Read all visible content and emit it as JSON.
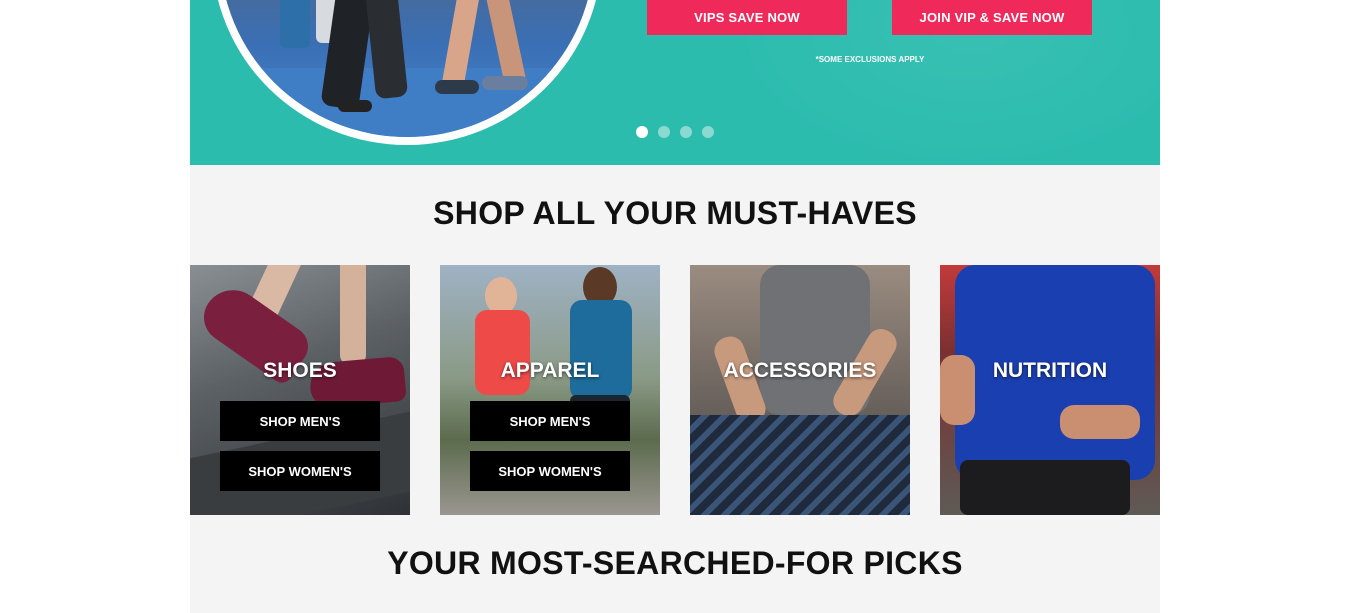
{
  "hero": {
    "btn_vips": "VIPS SAVE NOW",
    "btn_join": "JOIN VIP & SAVE NOW",
    "exclusions": "*SOME EXCLUSIONS APPLY",
    "carousel_active_index": 0,
    "carousel_count": 4
  },
  "sections": {
    "musthaves_title": "SHOP ALL YOUR MUST-HAVES",
    "picks_title": "YOUR MOST-SEARCHED-FOR PICKS"
  },
  "tiles": [
    {
      "label": "SHOES",
      "men": "SHOP MEN'S",
      "women": "SHOP WOMEN'S"
    },
    {
      "label": "APPAREL",
      "men": "SHOP MEN'S",
      "women": "SHOP WOMEN'S"
    },
    {
      "label": "ACCESSORIES"
    },
    {
      "label": "NUTRITION"
    }
  ],
  "colors": {
    "hero_bg": "#2bbcae",
    "accent_pink": "#ef2a5a",
    "page_bg": "#f4f4f4"
  }
}
